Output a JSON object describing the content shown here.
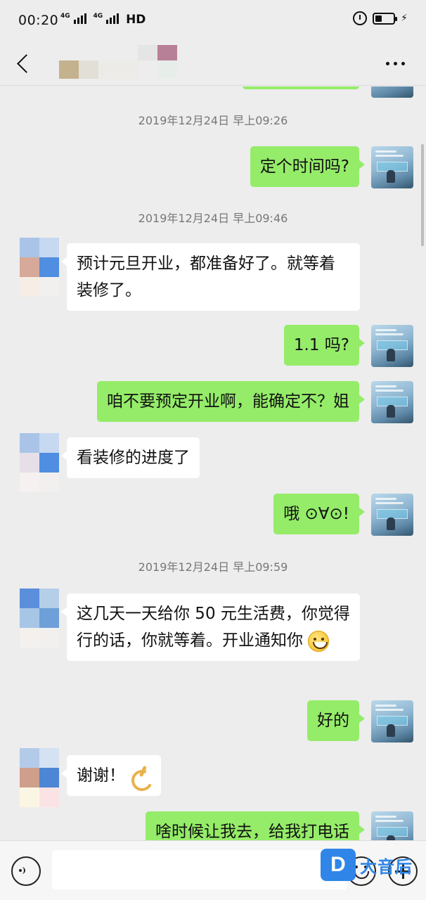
{
  "status_bar": {
    "time": "00:20",
    "network_1": "4G",
    "network_2": "4G",
    "hd": "HD",
    "icons": [
      "signal-icon",
      "alarm-icon",
      "battery-icon",
      "charging-icon"
    ]
  },
  "header": {
    "back_icon": "back-arrow-icon",
    "more_icon": "more-dots-icon"
  },
  "messages": [
    {
      "type": "timestamp",
      "text": "2019年12月24日 早上09:26"
    },
    {
      "type": "out",
      "text": "定个时间吗?"
    },
    {
      "type": "timestamp",
      "text": "2019年12月24日 早上09:46"
    },
    {
      "type": "in",
      "text": "预计元旦开业，都准备好了。就等着装修了。"
    },
    {
      "type": "out",
      "text": "1.1 吗?"
    },
    {
      "type": "out",
      "text": "咱不要预定开业啊，能确定不？姐"
    },
    {
      "type": "in",
      "text": "看装修的进度了"
    },
    {
      "type": "out",
      "text": "哦 ⊙∀⊙!"
    },
    {
      "type": "timestamp",
      "text": "2019年12月24日 早上09:59"
    },
    {
      "type": "in",
      "text": "这几天一天给你 50 元生活费，你觉得行的话，你就等着。开业通知你",
      "emoji": "grin-emoji"
    },
    {
      "type": "out",
      "text": "好的"
    },
    {
      "type": "in",
      "text": "谢谢！",
      "emoji": "ok-hand-emoji"
    },
    {
      "type": "out",
      "text": "啥时候让我去，给我打电话"
    }
  ],
  "input_bar": {
    "voice_icon": "voice-icon",
    "emoji_icon": "emoji-icon",
    "plus_icon": "plus-icon",
    "input_value": ""
  },
  "watermark": {
    "logo": "D",
    "text": "大音后"
  },
  "colors": {
    "outgoing_bubble": "#95ec69",
    "incoming_bubble": "#ffffff",
    "background": "#ededed",
    "watermark": "#2f86e8"
  }
}
